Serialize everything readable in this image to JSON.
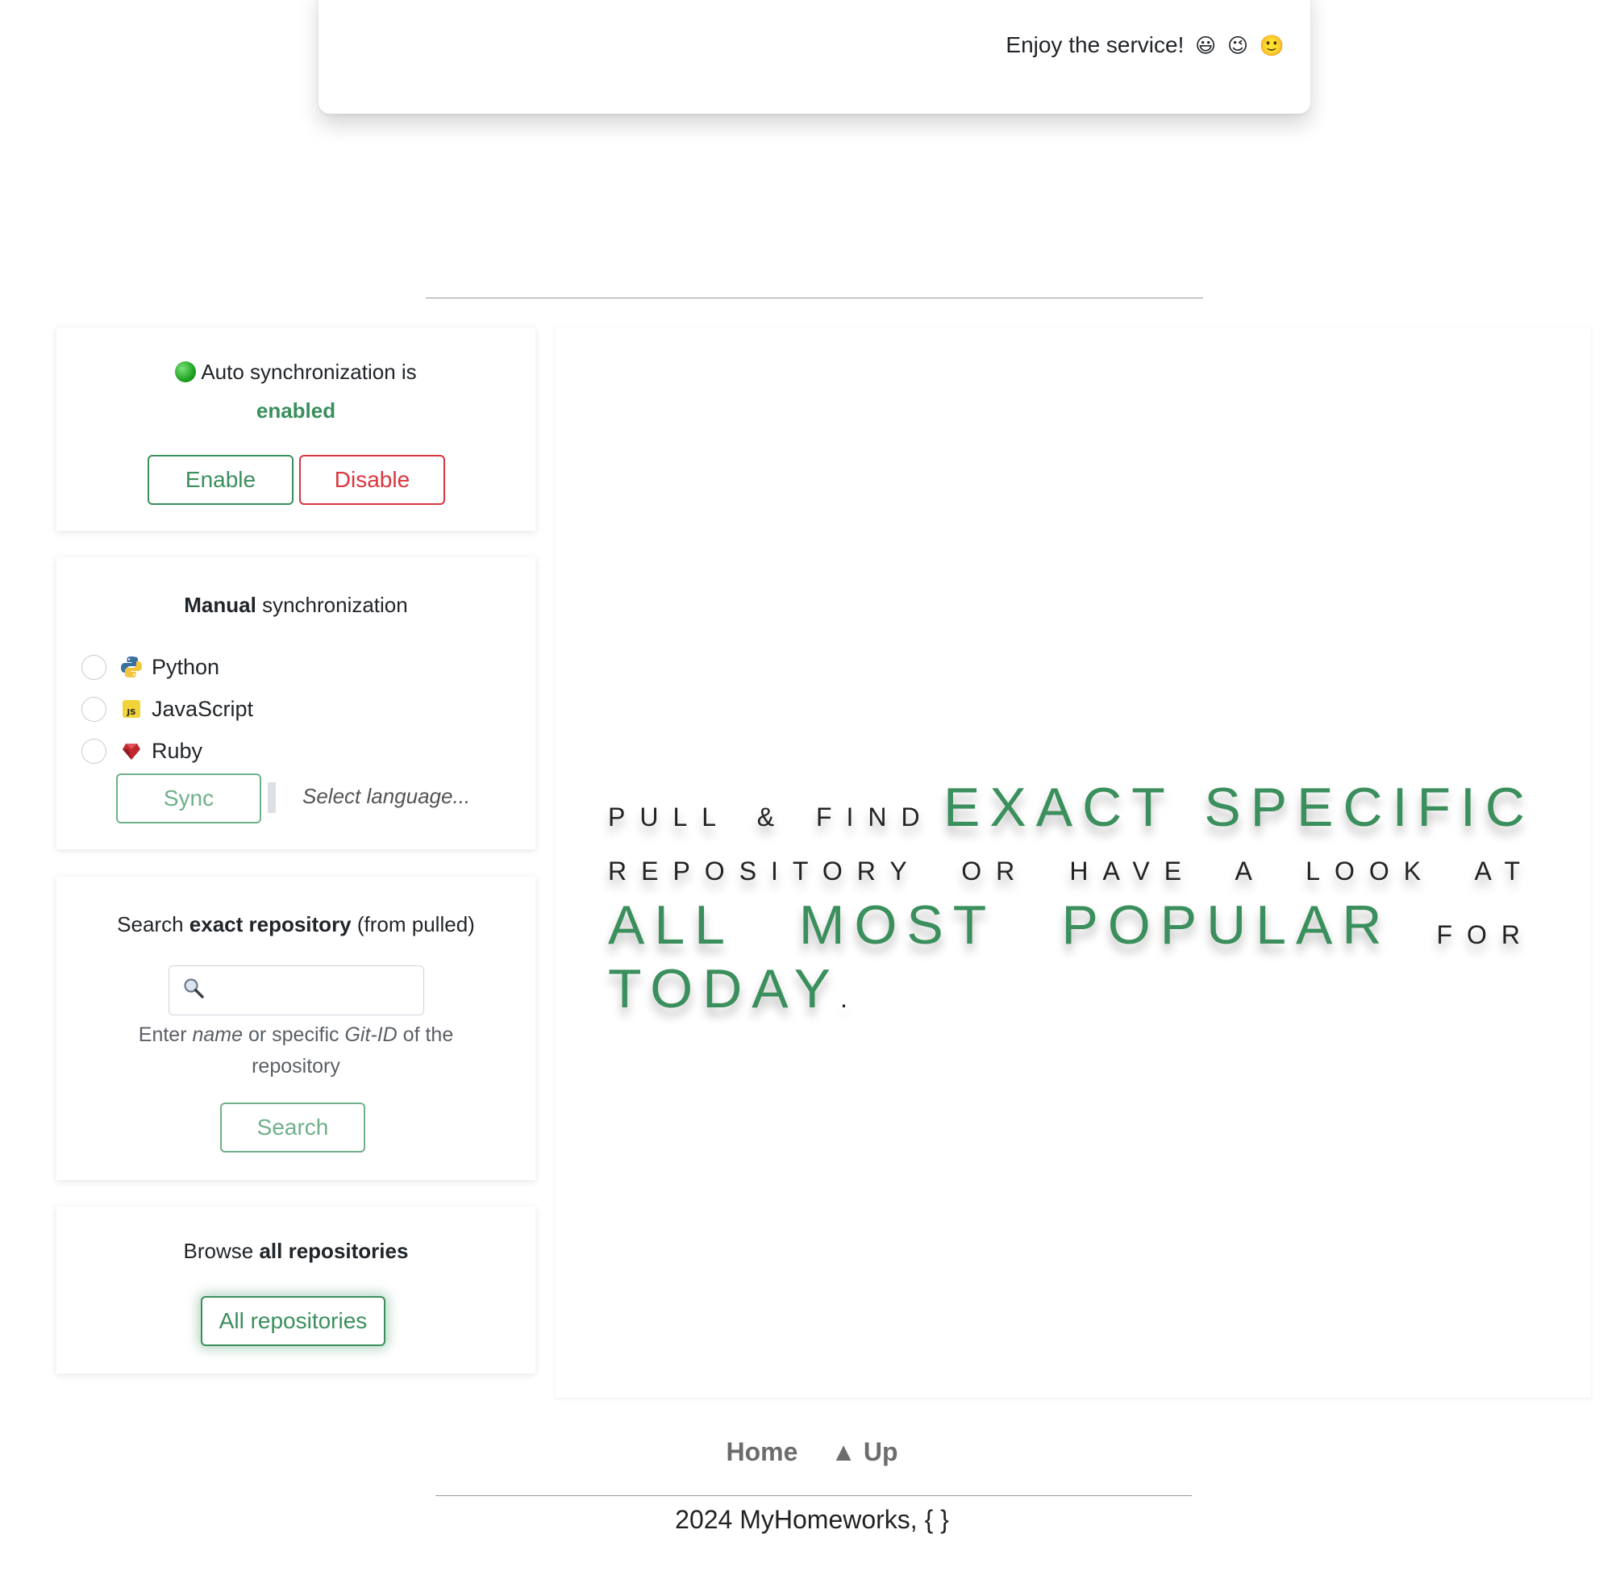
{
  "top_card": {
    "enjoy_text": "Enjoy the service!",
    "emojis": [
      "😃",
      "😉",
      "🙂"
    ]
  },
  "auto_sync": {
    "label": "Auto synchronization is",
    "status": "enabled",
    "status_color": "#3a8f5c",
    "enable_label": "Enable",
    "disable_label": "Disable"
  },
  "manual_sync": {
    "title_bold": "Manual",
    "title_rest": " synchronization",
    "languages": [
      {
        "label": "Python",
        "icon": "python-icon"
      },
      {
        "label": "JavaScript",
        "icon": "javascript-icon"
      },
      {
        "label": "Ruby",
        "icon": "ruby-icon"
      }
    ],
    "sync_label": "Sync",
    "hint": "Select language..."
  },
  "search": {
    "title_pre": "Search ",
    "title_bold": "exact repository",
    "title_post": " (from pulled)",
    "icon": "magnifier-icon",
    "placeholder": "",
    "help_pre": "Enter ",
    "help_name": "name",
    "help_mid": " or specific ",
    "help_gitid": "Git-ID",
    "help_post": " of the repository",
    "button_label": "Search"
  },
  "browse": {
    "title_pre": "Browse ",
    "title_bold": "all repositories",
    "button_label": "All repositories"
  },
  "hero": {
    "w1": "Pull & Find",
    "w2": "Exact Specific",
    "w3": "repository or have a look at",
    "w4": "All Most Popular",
    "w5": "for",
    "w6": "Today",
    "w7": ".",
    "accent_color": "#3a8f5c"
  },
  "footer": {
    "home_label": "Home",
    "up_label": "▲ Up",
    "copyright": "2024 MyHomeworks, { }"
  }
}
